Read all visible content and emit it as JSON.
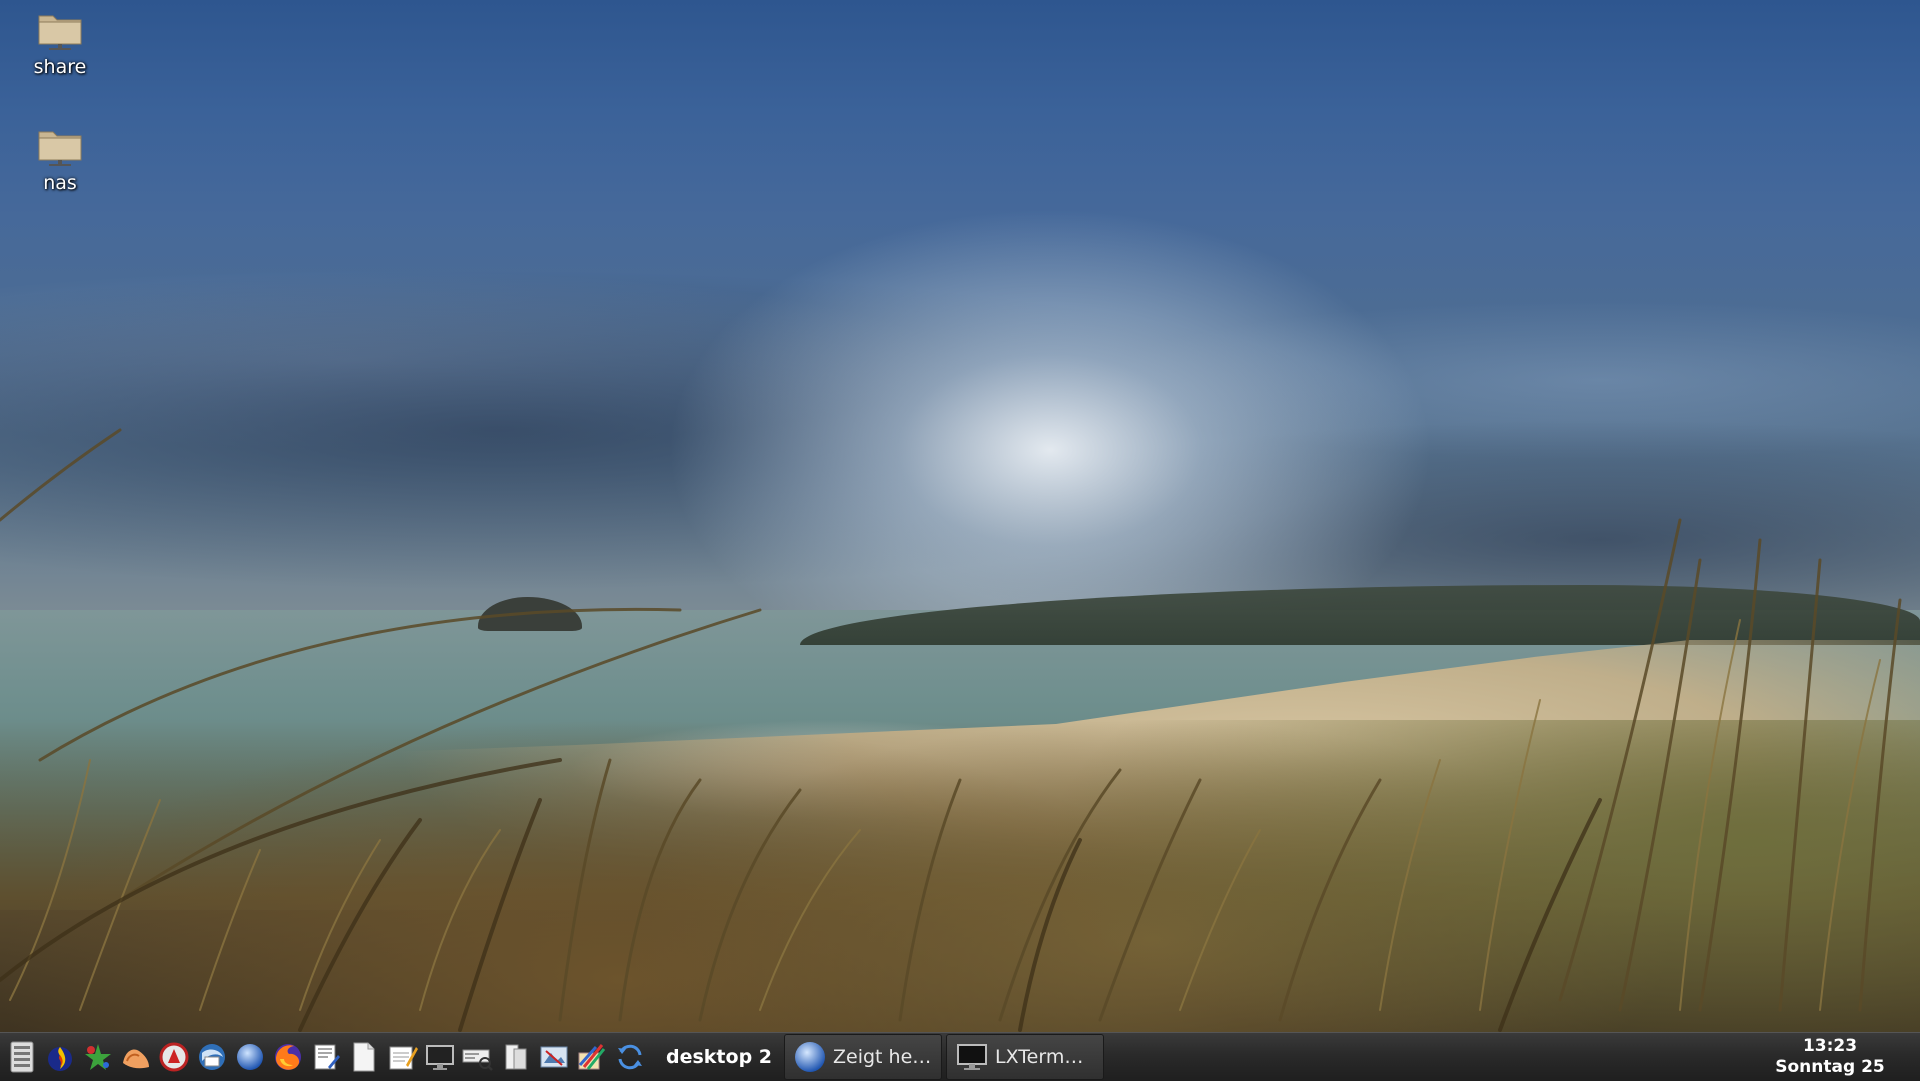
{
  "desktop": {
    "icons": [
      {
        "label": "share",
        "icon": "folder-network-icon"
      },
      {
        "label": "nas",
        "icon": "folder-network-icon"
      }
    ],
    "wallpaper": "beach-dunes-cloudy-sky"
  },
  "taskbar": {
    "launchers": [
      {
        "name": "menu",
        "icon": "application-menu-icon"
      },
      {
        "name": "fire-app",
        "icon": "fire-app-icon"
      },
      {
        "name": "star-app",
        "icon": "star-app-icon"
      },
      {
        "name": "hand-app",
        "icon": "hand-app-icon"
      },
      {
        "name": "guard-app",
        "icon": "guard-app-icon"
      },
      {
        "name": "mail",
        "icon": "mail-icon"
      },
      {
        "name": "globe-browser",
        "icon": "globe-icon"
      },
      {
        "name": "firefox",
        "icon": "firefox-icon"
      },
      {
        "name": "editor",
        "icon": "editor-icon"
      },
      {
        "name": "document",
        "icon": "document-icon"
      },
      {
        "name": "notes",
        "icon": "notes-icon"
      },
      {
        "name": "monitor",
        "icon": "monitor-icon"
      },
      {
        "name": "search-tool",
        "icon": "search-tool-icon"
      },
      {
        "name": "file-manager",
        "icon": "file-manager-icon"
      },
      {
        "name": "image-viewer",
        "icon": "image-viewer-icon"
      },
      {
        "name": "paint",
        "icon": "paint-icon"
      },
      {
        "name": "sync",
        "icon": "sync-icon"
      }
    ],
    "desktop_label": "desktop 2",
    "tasks": [
      {
        "title": "Zeigt he…",
        "icon": "globe-icon"
      },
      {
        "title": "LXTerm…",
        "icon": "terminal-icon"
      }
    ],
    "clock": {
      "time": "13:23",
      "date": "Sonntag 25"
    },
    "colors": {
      "bar": "#2a2a2a",
      "text": "#ffffff"
    }
  }
}
